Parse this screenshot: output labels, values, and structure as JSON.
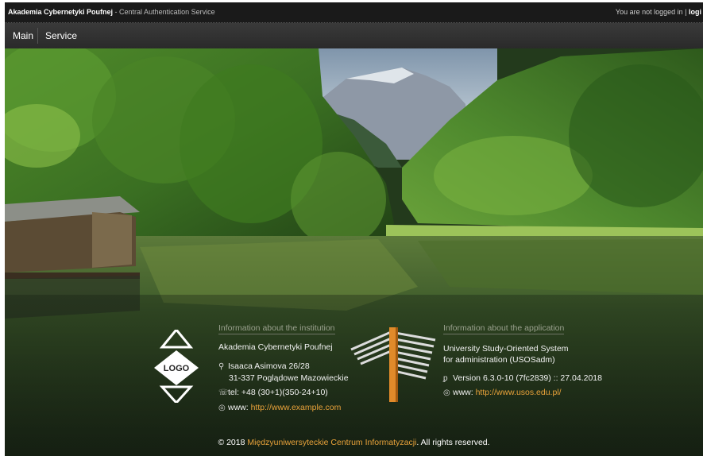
{
  "header": {
    "site_name": "Akademia Cybernetyki Poufnej",
    "site_sub": " - Central Authentication Service",
    "login_text": "You are not logged in | ",
    "login_link": "logi"
  },
  "nav": {
    "items": [
      {
        "label": "Main"
      },
      {
        "label": "Service"
      }
    ]
  },
  "institution": {
    "heading": "Information about the institution",
    "logo_text": "LOGO",
    "name": "Akademia Cybernetyki Poufnej",
    "address1": "Isaaca Asimova 26/28",
    "address2": "31-337 Poglądowe Mazowieckie",
    "tel": "tel: +48 (30+1)(350-24+10)",
    "www_label": "www: ",
    "www_link": "http://www.example.com"
  },
  "application": {
    "heading": "Information about the application",
    "line1": "University Study-Oriented System",
    "line2": "for administration (USOSadm)",
    "version": "Version 6.3.0-10 (7fc2839) :: 27.04.2018",
    "www_label": "www: ",
    "www_link": "http://www.usos.edu.pl/"
  },
  "footer": {
    "prefix": "© 2018 ",
    "link": "Międzyuniwersyteckie Centrum Informatyzacji",
    "suffix": ". All rights reserved."
  },
  "colors": {
    "link": "#e8a23a",
    "topbar": "#1a1a1a",
    "navbar": "#333333"
  },
  "icons": [
    "map-marker-icon",
    "phone-icon",
    "globe-icon",
    "version-icon",
    "globe-icon"
  ]
}
